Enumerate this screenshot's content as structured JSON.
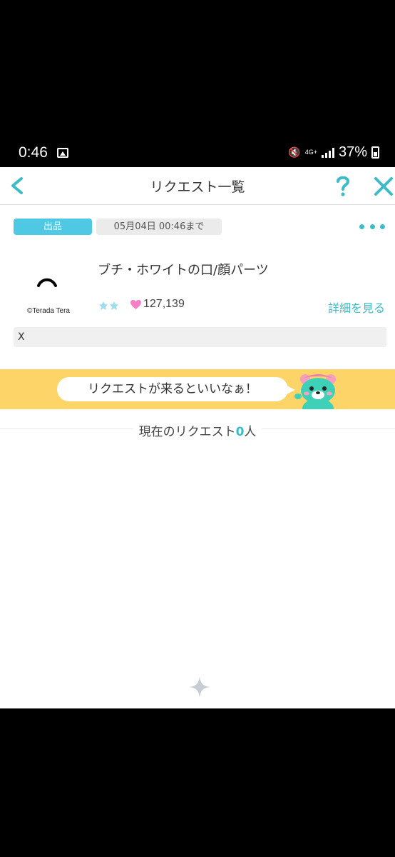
{
  "status_bar": {
    "time": "0:46",
    "gallery_icon": "image-icon",
    "mute_icon": "vibrate-mute-icon",
    "network": "4G+",
    "battery": "37%"
  },
  "header": {
    "back_icon": "chevron-left-icon",
    "title": "リクエスト一覧",
    "help_label": "?",
    "close_icon": "close-icon"
  },
  "item": {
    "status_badge": "出品",
    "deadline": "05月04日 00:46まで",
    "more_icon": "more-dots-icon",
    "thumbnail_credit": "©Terada Tera",
    "title": "ブチ・ホワイトの口/顔パーツ",
    "likes": "127,139",
    "detail_link": "詳細を見る",
    "comment": "X"
  },
  "banner": {
    "message": "リクエストが来るといいなぁ！",
    "mascot_icon": "bear-mascot-icon"
  },
  "requests": {
    "prefix": "現在のリクエスト",
    "count": "0",
    "suffix": "人"
  },
  "colors": {
    "accent": "#3bbcc8",
    "badge": "#4ec8e3",
    "banner": "#fdd468",
    "heart": "#f77fc6"
  }
}
